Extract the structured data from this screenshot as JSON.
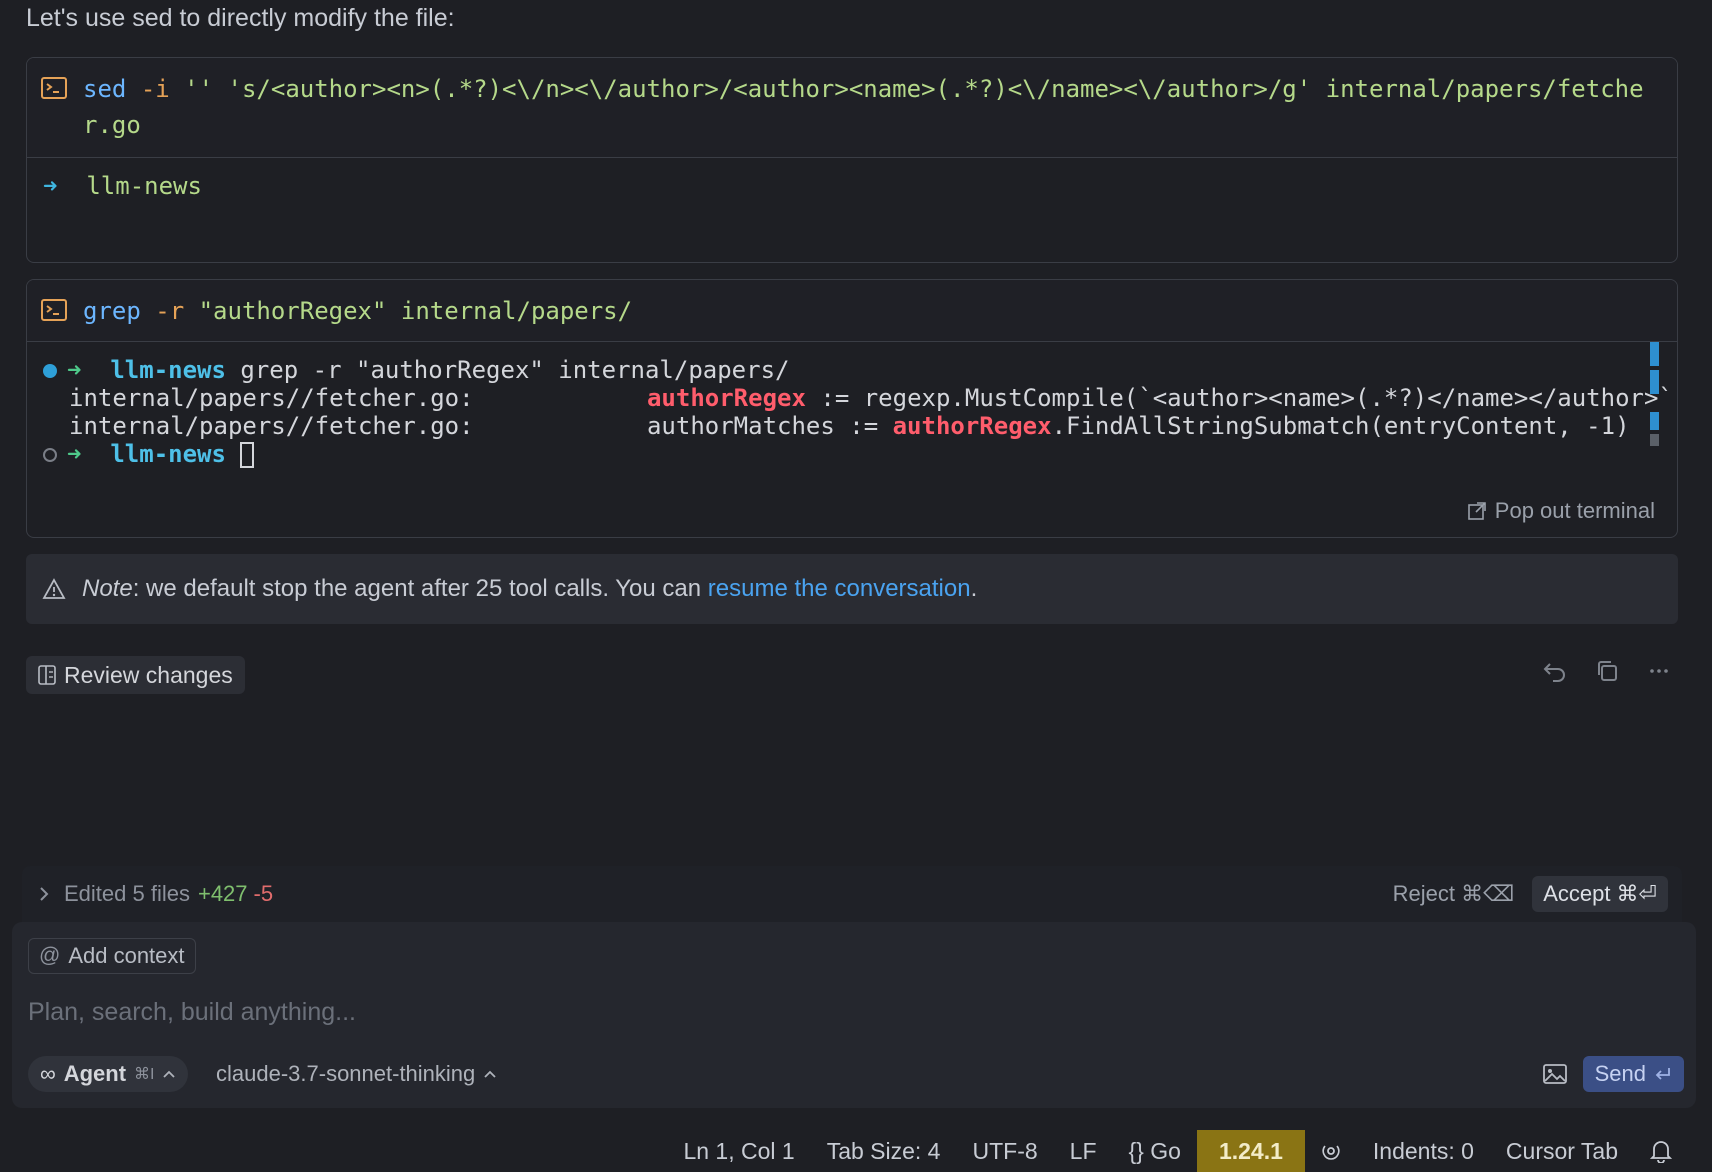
{
  "intro": "Let's use sed to directly modify the file:",
  "term1": {
    "cmd_kw": "sed",
    "cmd_flag": "-i",
    "cmd_rest": " '' 's/<author><n>(.*?)<\\/n><\\/author>/<author><name>(.*?)<\\/name><\\/author>/g' internal/papers/fetcher.go",
    "out_arrow": "➜",
    "out_dir": "llm-news"
  },
  "term2": {
    "cmd_kw": "grep",
    "cmd_flag": "-r",
    "cmd_rest": " \"authorRegex\" internal/papers/",
    "line1_dir": "llm-news",
    "line1_cmd": " grep -r \"authorRegex\" internal/papers/",
    "line2_prefix": "internal/papers//fetcher.go:            ",
    "line2_hl": "authorRegex",
    "line2_rest": " := regexp.MustCompile(`<author><name>(.*?)</name></author>`)",
    "line3_prefix": "internal/papers//fetcher.go:            authorMatches := ",
    "line3_hl": "authorRegex",
    "line3_rest": ".FindAllStringSubmatch(entryContent, -1)",
    "line4_dir": "llm-news",
    "arrow": "➜",
    "popout": "Pop out terminal"
  },
  "note": {
    "label": "Note",
    "text": ": we default stop the agent after 25 tool calls. You can ",
    "link": "resume the conversation",
    "end": "."
  },
  "review_label": "Review changes",
  "edited": {
    "text": "Edited 5 files",
    "plus": "+427",
    "minus": "-5",
    "reject": "Reject ⌘⌫",
    "accept": "Accept ⌘⏎"
  },
  "composer": {
    "add_context": "Add context",
    "placeholder": "Plan, search, build anything...",
    "agent": "Agent",
    "agent_shortcut": "⌘I",
    "model": "claude-3.7-sonnet-thinking",
    "send": "Send"
  },
  "statusbar": {
    "position": "Ln 1, Col 1",
    "tab_size": "Tab Size: 4",
    "encoding": "UTF-8",
    "eol": "LF",
    "language": "{} Go",
    "version": "1.24.1",
    "indents": "Indents: 0",
    "cursor_tab": "Cursor Tab"
  },
  "colors": {
    "accent_blue": "#4aa3f0",
    "highlight_red": "#ff5d6c",
    "version_bg": "#8a7414",
    "send_bg": "#3b4f86"
  }
}
